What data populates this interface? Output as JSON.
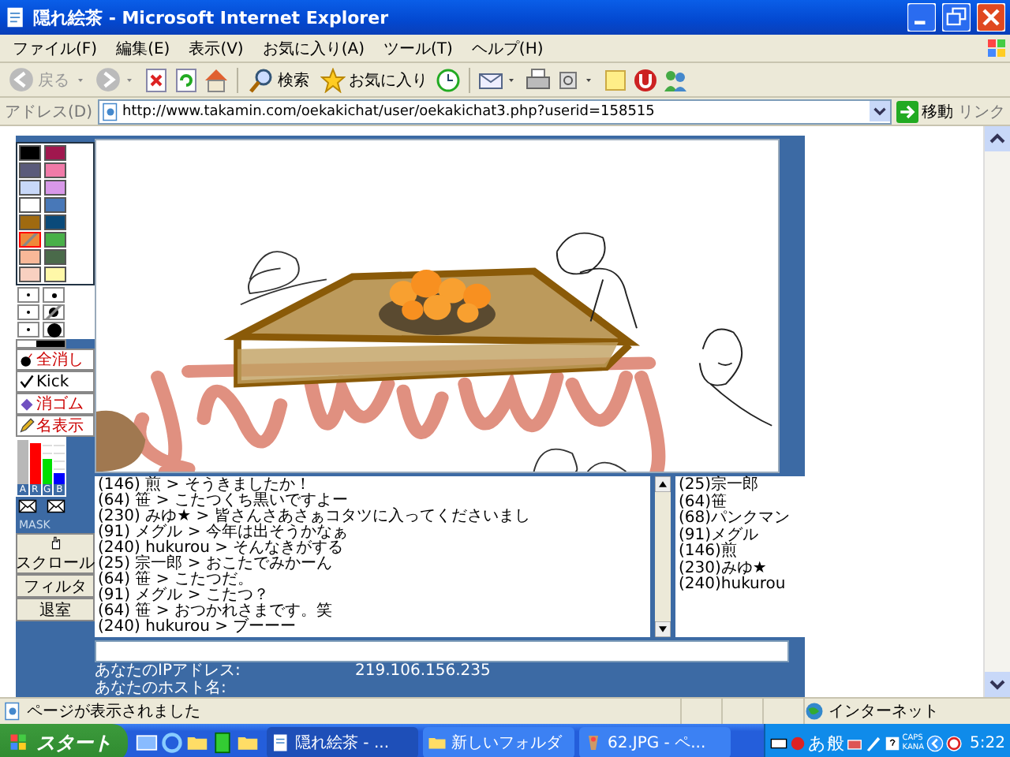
{
  "window": {
    "title": "隠れ絵茶 - Microsoft Internet Explorer"
  },
  "menu": [
    "ファイル(F)",
    "編集(E)",
    "表示(V)",
    "お気に入り(A)",
    "ツール(T)",
    "ヘルプ(H)"
  ],
  "toolbar": {
    "back": {
      "label": "戻る",
      "disabled": true
    },
    "search": {
      "label": "検索"
    },
    "favorites": {
      "label": "お気に入り"
    }
  },
  "address_bar": {
    "label": "アドレス(D)",
    "url": "http://www.takamin.com/oekakichat/user/oekakichat3.php?userid=158515",
    "go": "移動",
    "links": "リンク"
  },
  "applet": {
    "palette": [
      {
        "color": "#000000",
        "selected": false
      },
      {
        "color": "#a0174e",
        "selected": false
      },
      {
        "color": "#5a5a7a",
        "selected": false
      },
      {
        "color": "#f07aa8",
        "selected": false
      },
      {
        "color": "#c8d8f8",
        "selected": false
      },
      {
        "color": "#d898e8",
        "selected": false
      },
      {
        "color": "#ffffff",
        "selected": false
      },
      {
        "color": "#4878b8",
        "selected": false
      },
      {
        "color": "#a06a10",
        "selected": false
      },
      {
        "color": "#0a4a7a",
        "selected": false
      },
      {
        "color": "#f08838",
        "selected": true
      },
      {
        "color": "#48b048",
        "selected": false
      },
      {
        "color": "#f8b898",
        "selected": false
      },
      {
        "color": "#4a6a4a",
        "selected": false
      },
      {
        "color": "#f8d0c0",
        "selected": false
      },
      {
        "color": "#fff8a8",
        "selected": false
      }
    ],
    "pen_sizes": [
      {
        "selected": false
      },
      {
        "selected": false
      },
      {
        "selected": false
      },
      {
        "selected": true
      },
      {
        "selected": false
      },
      {
        "selected": false
      }
    ],
    "tool_buttons": [
      "全消し",
      "Kick",
      "消ゴム",
      "名表示"
    ],
    "rgb_meter": [
      {
        "label": "A",
        "color": "#b8b8b8",
        "level": 0.95
      },
      {
        "label": "R",
        "color": "#ff0000",
        "level": 0.9
      },
      {
        "label": "G",
        "color": "#00e000",
        "level": 0.55
      },
      {
        "label": "B",
        "color": "#0000ff",
        "level": 0.25
      }
    ],
    "mask_label": "MASK",
    "scroll_button": "スクロール",
    "filter_button": "フィルタ",
    "exit_button": "退室",
    "chat_log": [
      "(146) 煎 > そうきましたか！",
      "(64) 笹 > こたつくち黒いですよー",
      "(230) みゆ★ > 皆さんさあさぁコタツに入ってくださいまし",
      "(91) メグル > 今年は出そうかなぁ",
      "(240) hukurou > そんなきがする",
      "(25) 宗一郎 > おこたでみかーん",
      "(64) 笹 > こたつだ。",
      "(91) メグル > こたつ？",
      "(64) 笹 > おつかれさまです。笑",
      "(240) hukurou > ブーーー"
    ],
    "user_list": [
      "(25)宗一郎",
      "(64)笹",
      "(68)パンクマン",
      "(91)メグル",
      "(146)煎",
      "(230)みゆ★",
      "(240)hukurou"
    ],
    "info": [
      {
        "label": "あなたのIPアドレス:",
        "value": "219.106.156.235"
      },
      {
        "label": "あなたのホスト名:"
      }
    ]
  },
  "status_bar": {
    "text": "ページが表示されました",
    "zone": "インターネット"
  },
  "taskbar": {
    "start": "スタート",
    "tasks": [
      {
        "label": "隠れ絵茶 - ...",
        "selected": true
      },
      {
        "label": "新しいフォルダ",
        "selected": false
      },
      {
        "label": "62.JPG - ペ...",
        "selected": false
      }
    ],
    "ime": [
      "あ",
      "般"
    ],
    "locks": [
      "CAPS",
      "KANA"
    ],
    "clock": "5:22"
  }
}
